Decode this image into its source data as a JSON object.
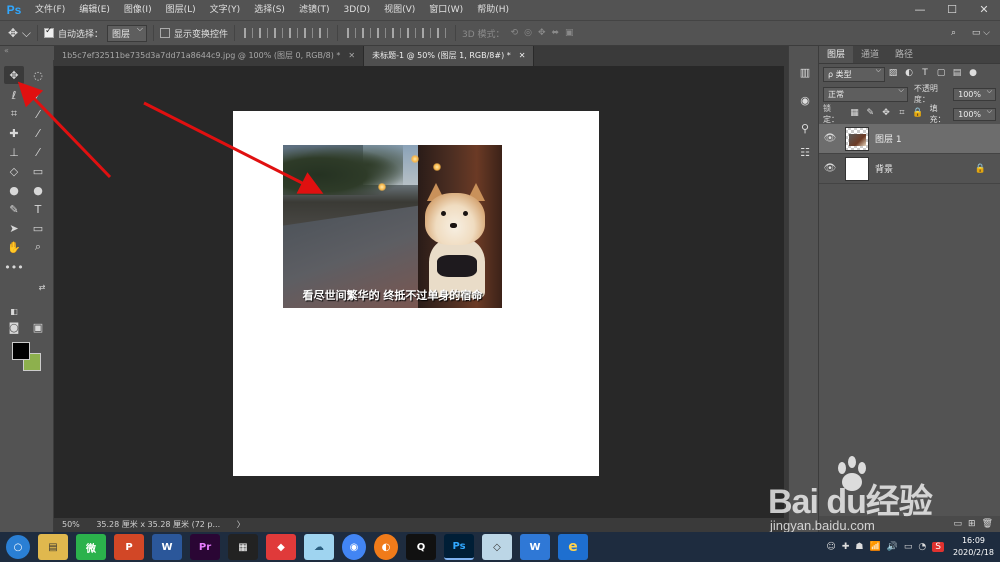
{
  "app": {
    "logo": "Ps"
  },
  "menu": [
    "文件(F)",
    "编辑(E)",
    "图像(I)",
    "图层(L)",
    "文字(Y)",
    "选择(S)",
    "滤镜(T)",
    "3D(D)",
    "视图(V)",
    "窗口(W)",
    "帮助(H)"
  ],
  "window_controls": {
    "minimize": "—",
    "maximize": "☐",
    "close": "✕"
  },
  "options": {
    "auto_select_label": "自动选择：",
    "auto_select_value": "图层",
    "show_transform_label": "显示变换控件",
    "mode_3d_label": "3D 模式："
  },
  "tabs": [
    {
      "label": "1b5c7ef32511be735d3a7dd71a8644c9.jpg @ 100% (图层 0, RGB/8) *",
      "close": "✕"
    },
    {
      "label": "未标题-1 @ 50% (图层 1, RGB/8#) *",
      "close": "✕"
    }
  ],
  "photo": {
    "caption": "看尽世间繁华的 终抵不过单身的宿命"
  },
  "status": {
    "zoom": "50%",
    "doc_size": "35.28 厘米 x 35.28 厘米 (72 p...",
    "more": "〉"
  },
  "layers_panel": {
    "tabs": [
      "图层",
      "通道",
      "路径"
    ],
    "kind_filter": "ρ 类型",
    "blend_mode": "正常",
    "opacity_label": "不透明度：",
    "opacity_value": "100%",
    "lock_label": "锁定：",
    "fill_label": "填充：",
    "fill_value": "100%",
    "layers": [
      {
        "name": "图层 1"
      },
      {
        "name": "背景"
      }
    ]
  },
  "watermark": {
    "main": "Bai  du经验",
    "url": "jingyan.baidu.com"
  },
  "taskbar": {
    "apps": [
      "○",
      "▤",
      "微",
      "P",
      "W",
      "Pr",
      "▦",
      "◆",
      "☁",
      "◉",
      "◐",
      "Q",
      "Ps",
      "◇",
      "W",
      "e"
    ],
    "tray_s": "S",
    "time": "16:09",
    "date": "2020/2/18"
  },
  "colors": {
    "foreground": "#000000",
    "background": "#8db04d",
    "arrow": "#e01010",
    "ps_blue": "#31a8ff"
  }
}
